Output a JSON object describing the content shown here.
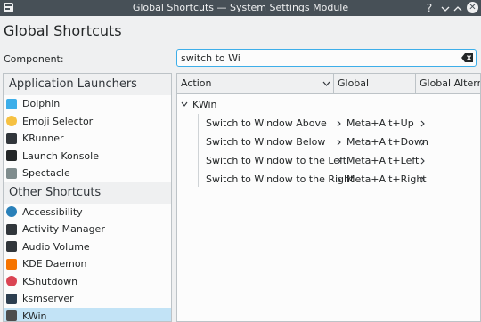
{
  "window": {
    "title": "Global Shortcuts — System Settings Module",
    "help_glyph": "?",
    "minimize_glyph": "⌄",
    "maximize_glyph": "⌃",
    "close_glyph": "✕"
  },
  "page": {
    "title": "Global Shortcuts"
  },
  "component": {
    "label": "Component:",
    "search_value": "switch to Wi"
  },
  "left_panel": {
    "groups": [
      {
        "title": "Application Launchers",
        "items": [
          {
            "label": "Dolphin",
            "icon": "dolphin-icon",
            "color": "#3daee9"
          },
          {
            "label": "Emoji Selector",
            "icon": "emoji-icon",
            "color": "#f6c142"
          },
          {
            "label": "KRunner",
            "icon": "krunner-icon",
            "color": "#31363b"
          },
          {
            "label": "Launch Konsole",
            "icon": "konsole-icon",
            "color": "#232627"
          },
          {
            "label": "Spectacle",
            "icon": "spectacle-icon",
            "color": "#7f8c8d"
          }
        ]
      },
      {
        "title": "Other Shortcuts",
        "items": [
          {
            "label": "Accessibility",
            "icon": "accessibility-icon",
            "color": "#2980b9"
          },
          {
            "label": "Activity Manager",
            "icon": "activity-manager-icon",
            "color": "#31363b"
          },
          {
            "label": "Audio Volume",
            "icon": "audio-volume-icon",
            "color": "#31363b"
          },
          {
            "label": "KDE Daemon",
            "icon": "kde-daemon-icon",
            "color": "#f67400"
          },
          {
            "label": "KShutdown",
            "icon": "kshutdown-icon",
            "color": "#da4453"
          },
          {
            "label": "ksmserver",
            "icon": "ksmserver-icon",
            "color": "#2c3e50"
          },
          {
            "label": "KWin",
            "icon": "kwin-icon",
            "color": "#4d4d4d",
            "selected": true
          }
        ]
      }
    ]
  },
  "table": {
    "columns": [
      "Action",
      "Global",
      "Global Alternate"
    ],
    "group": "KWin",
    "rows": [
      {
        "action": "Switch to Window Above",
        "shortcut": "Meta+Alt+Up"
      },
      {
        "action": "Switch to Window Below",
        "shortcut": "Meta+Alt+Down"
      },
      {
        "action": "Switch to Window to the Left",
        "shortcut": "Meta+Alt+Left"
      },
      {
        "action": "Switch to Window to the Right",
        "shortcut": "Meta+Alt+Right"
      }
    ]
  },
  "colors": {
    "titlebar": "#475057",
    "accent": "#3daee9",
    "selection": "#c2e3f6",
    "panel_bg": "#fcfcfc",
    "window_bg": "#eff0f1"
  }
}
